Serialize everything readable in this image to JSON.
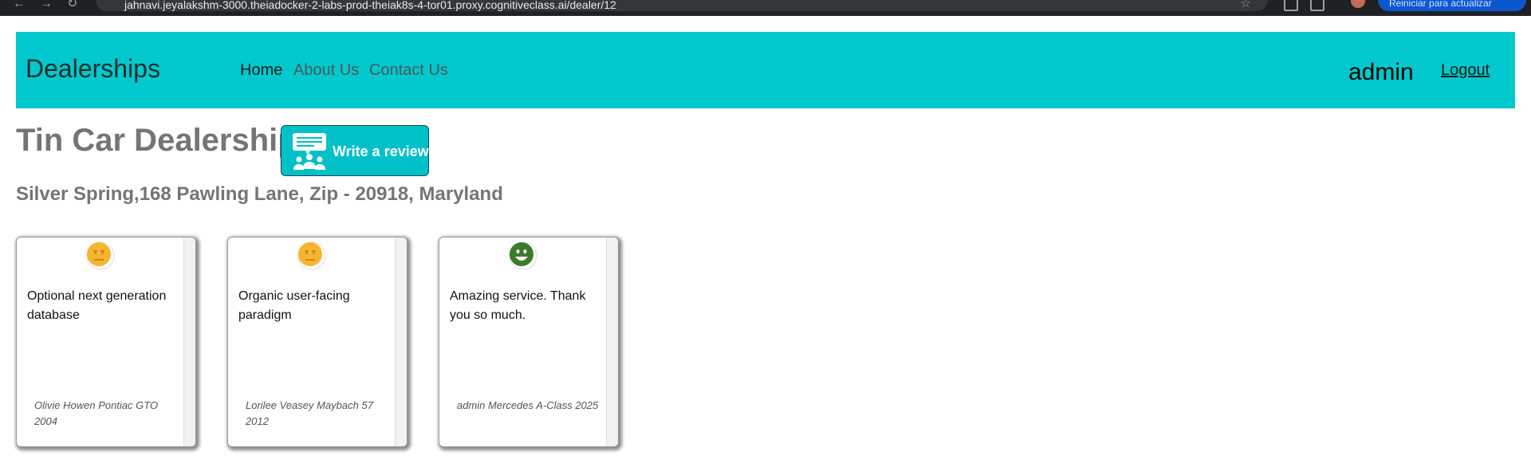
{
  "browser": {
    "url": "jahnavi.jeyalakshm-3000.theiadocker-2-labs-prod-theiak8s-4-tor01.proxy.cognitiveclass.ai/dealer/12",
    "update_label": "Reiniciar para actualizar"
  },
  "navbar": {
    "brand": "Dealerships",
    "links": [
      {
        "label": "Home"
      },
      {
        "label": "About Us"
      },
      {
        "label": "Contact Us"
      }
    ],
    "username": "admin",
    "logout_label": "Logout",
    "background": "#00c8cc"
  },
  "dealer": {
    "name": "Tin Car Dealership",
    "address": "Silver Spring,168 Pawling Lane, Zip - 20918, Maryland",
    "review_button_label": "Write a review"
  },
  "reviews": [
    {
      "text": "Optional next generation database",
      "reviewer": "Olivie Howen Pontiac GTO 2004",
      "sentiment": "neutral",
      "icon": "neutral-face-icon"
    },
    {
      "text": "Organic user-facing paradigm",
      "reviewer": "Lorilee Veasey Maybach 57 2012",
      "sentiment": "neutral",
      "icon": "neutral-face-icon"
    },
    {
      "text": "Amazing service. Thank you so much.",
      "reviewer": "admin Mercedes A-Class 2025",
      "sentiment": "positive",
      "icon": "smiley-face-icon"
    }
  ],
  "colors": {
    "neutral": "#f6b531",
    "positive": "#3e7a2c",
    "button": "#00c0c8"
  }
}
